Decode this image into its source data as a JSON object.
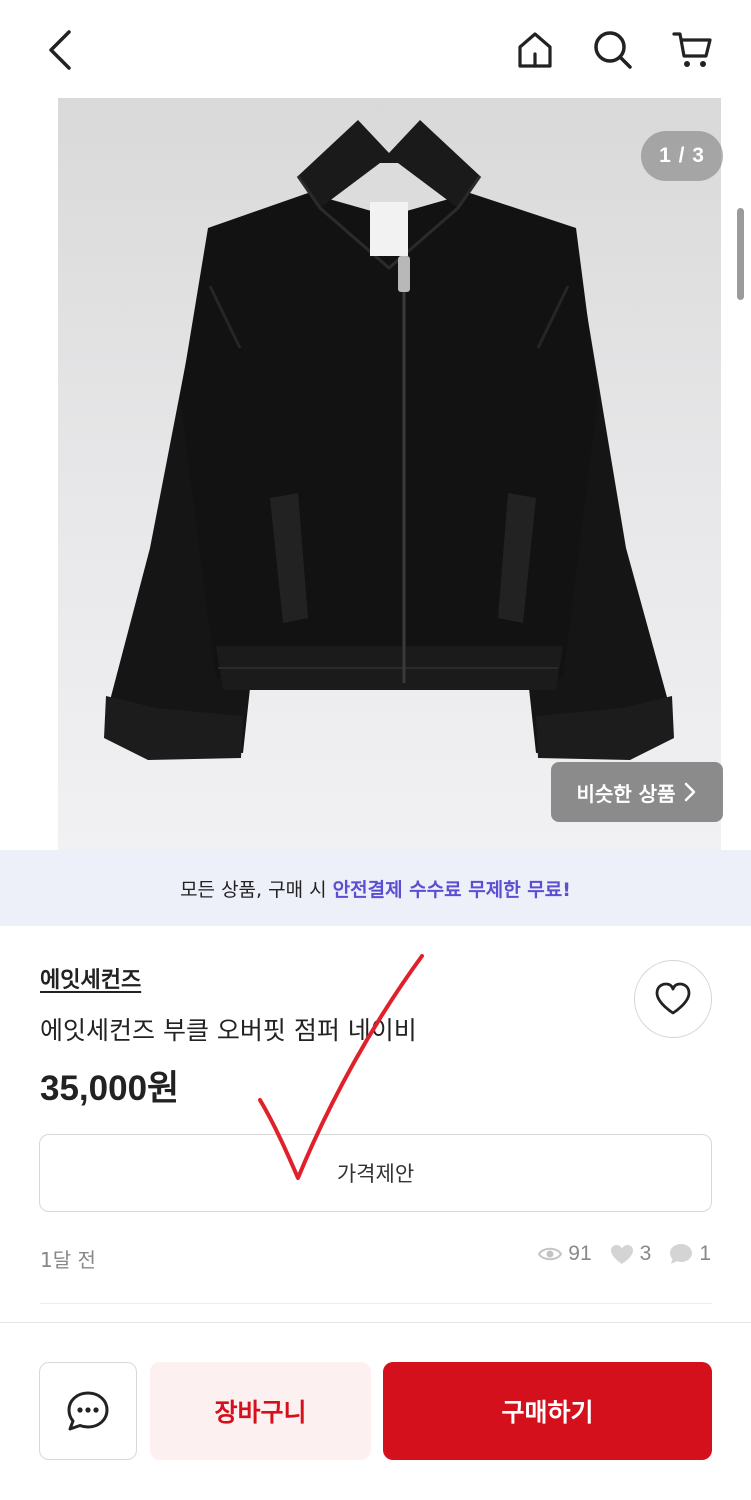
{
  "header": {
    "icons": [
      "chevron-left-icon",
      "home-icon",
      "search-icon",
      "cart-icon"
    ]
  },
  "gallery": {
    "counter": "1 / 3",
    "similar_label": "비슷한 상품"
  },
  "promo": {
    "prefix": "모든 상품, 구매 시 ",
    "highlight": "안전결제 수수료 무제한 무료!"
  },
  "product": {
    "brand": "에잇세컨즈",
    "title": "에잇세컨즈 부클 오버핏 점퍼 네이비",
    "price": "35,000원",
    "offer_label": "가격제안",
    "posted": "1달 전",
    "views": "91",
    "likes": "3",
    "chats": "1"
  },
  "actions": {
    "cart_label": "장바구니",
    "buy_label": "구매하기"
  },
  "colors": {
    "accent_red": "#d3101c",
    "promo_highlight": "#5b4fd1",
    "annotation_red": "#e0202a"
  }
}
